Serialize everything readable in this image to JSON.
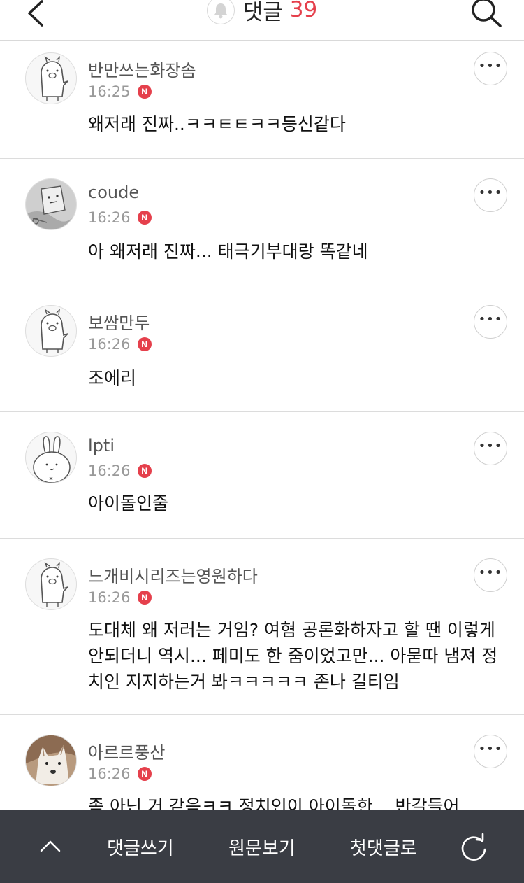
{
  "header": {
    "title": "댓글",
    "count": "39"
  },
  "comments": [
    {
      "nick": "반만쓰는화장솜",
      "time": "16:25",
      "badge": "N",
      "body": "왜저래 진짜..ㅋㅋㅌㅌㅋㅋ등신같다",
      "avatar": "pig-avatar"
    },
    {
      "nick": "coude",
      "time": "16:26",
      "badge": "N",
      "body": "아 왜저래 진짜... 태극기부대랑 똑같네",
      "avatar": "sketch-photo-avatar"
    },
    {
      "nick": "보쌈만두",
      "time": "16:26",
      "badge": "N",
      "body": "조에리",
      "avatar": "pig-avatar"
    },
    {
      "nick": "lpti",
      "time": "16:26",
      "badge": "N",
      "body": "아이돌인줄",
      "avatar": "rabbit-avatar"
    },
    {
      "nick": "느개비시리즈는영원하다",
      "time": "16:26",
      "badge": "N",
      "body": "도대체 왜 저러는 거임? 여혐 공론화하자고 할 땐 이렇게 안되더니 역시... 페미도 한 줌이었고만... 아묻따 냄져 정치인 지지하는거 봐ㅋㅋㅋㅋㅋ 존나 길티임",
      "avatar": "pig-avatar"
    },
    {
      "nick": "아르르풍산",
      "time": "16:26",
      "badge": "N",
      "body": "좀 아닌 거 같음ㅋㅋ 정치인이 아이돌한... 반갈들어",
      "avatar": "dog-photo-avatar"
    }
  ],
  "bottom_bar": {
    "write": "댓글쓰기",
    "original": "원문보기",
    "first": "첫댓글로"
  },
  "icons": {
    "back": "back-chevron-icon",
    "bell": "bell-icon",
    "search": "search-icon",
    "more": "more-dots-icon",
    "up": "chevron-up-icon",
    "refresh": "refresh-icon"
  },
  "colors": {
    "accent": "#e5404c",
    "bottom_bar": "#3a3d44"
  }
}
